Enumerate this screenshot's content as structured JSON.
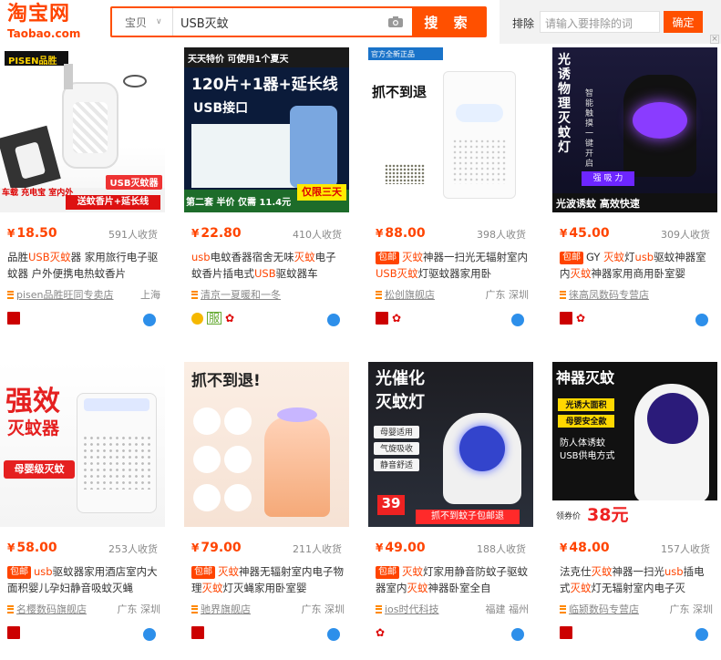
{
  "header": {
    "logo_cn": "淘宝网",
    "logo_en": "Taobao.com",
    "category": "宝贝",
    "search_value": "USB灭蚊",
    "search_button": "搜 索",
    "exclude_label": "排除",
    "exclude_placeholder": "请输入要排除的词",
    "exclude_button": "确定"
  },
  "products": [
    {
      "price": "18.50",
      "sales": "591人收货",
      "title_pre": "品胜",
      "shop": "pisen品胜旺同专卖店",
      "loc": "上海",
      "img": {
        "t1": "PISEN品胜",
        "t2": "车载 充电宝 室内外",
        "t3": "USB灭蚊器",
        "t4": "送蚊香片+延长线"
      }
    },
    {
      "price": "22.80",
      "sales": "410人收货",
      "shop": "清京一夏暖和一冬",
      "loc": "",
      "img": {
        "t1": "天天特价 可使用1个夏天",
        "t2": "120片+1器+延长线",
        "t3": "USB接口",
        "t4": "第二套 半价 仅需 11.4元",
        "t5": "仅限三天"
      }
    },
    {
      "price": "88.00",
      "sales": "398人收货",
      "shop": "松创旗舰店",
      "loc": "广东 深圳",
      "img": {
        "t1": "官方全新正品",
        "t2": "抓不到退"
      }
    },
    {
      "price": "45.00",
      "sales": "309人收货",
      "shop": "徕高凤数码专营店",
      "loc": "",
      "img": {
        "t1": "光诱物理灭蚊灯",
        "t2": "智能触摸 一键开启",
        "t3": "强 吸 力",
        "t4": "光波诱蚊 高效快速"
      }
    },
    {
      "price": "58.00",
      "sales": "253人收货",
      "shop": "名樱数码旗舰店",
      "loc": "广东 深圳",
      "img": {
        "t1": "强效",
        "t2": "灭蚊器",
        "t3": "母婴级灭蚊"
      }
    },
    {
      "price": "79.00",
      "sales": "211人收货",
      "shop": "驰界旗舰店",
      "loc": "广东 深圳",
      "img": {
        "t1": "抓不到退!"
      }
    },
    {
      "price": "49.00",
      "sales": "188人收货",
      "shop": "ios时代科技",
      "loc": "福建 福州",
      "img": {
        "t1": "光催化",
        "t2": "灭蚊灯",
        "t3": "母婴适用",
        "t4": "气旋吸收",
        "t5": "静音舒适",
        "t6": "39",
        "t7": "抓不到蚊子包邮退"
      }
    },
    {
      "price": "48.00",
      "sales": "157人收货",
      "shop": "临颍数码专营店",
      "loc": "广东 深圳",
      "img": {
        "t1": "神器灭蚊",
        "t2": "光诱大面积",
        "t3": "母婴安全款",
        "t4": "防人体诱蚊",
        "t5": "USB供电方式",
        "t6": "38元",
        "t7": "领券价"
      }
    }
  ],
  "titles": [
    {
      "a": "品胜",
      "b": "USB灭蚊",
      "c": "器 家用旅行电子驱蚊器 户外便携电热蚊香片"
    },
    {
      "a": "usb",
      "b": "电蚊香器宿舍无味",
      "c": ""
    },
    {
      "a": "",
      "b": "",
      "c": ""
    },
    {
      "a": "",
      "b": "",
      "c": ""
    },
    {
      "a": "",
      "b": "",
      "c": ""
    },
    {
      "a": "",
      "b": "",
      "c": ""
    },
    {
      "a": "",
      "b": "",
      "c": ""
    },
    {
      "a": "",
      "b": "",
      "c": ""
    }
  ],
  "title_text": [
    "品胜USB灭蚊器 家用旅行电子驱蚊器 户外便携电热蚊香片",
    "usb电蚊香器宿舍无味灭蚊电子蚊香片插电式USB驱蚊器车",
    "灭蚊神器一扫光无辐射室内USB灭蚊灯驱蚊器家用卧",
    "GY 灭蚊灯usb驱蚊神器室内灭蚊神器家用商用卧室婴",
    "usb驱蚊器家用酒店室内大面积婴儿孕妇静音吸蚊灭蝇",
    "灭蚊神器无辐射室内电子物理灭蚊灯灭蝇家用卧室婴",
    "灭蚊灯家用静音防蚊子驱蚊器室内灭蚊神器卧室全自",
    "法克仕灭蚊神器一扫光usb插电式灭蚊灯无辐射室内电子灭"
  ],
  "tags": {
    "baoyou": "包邮"
  },
  "currency": "¥"
}
